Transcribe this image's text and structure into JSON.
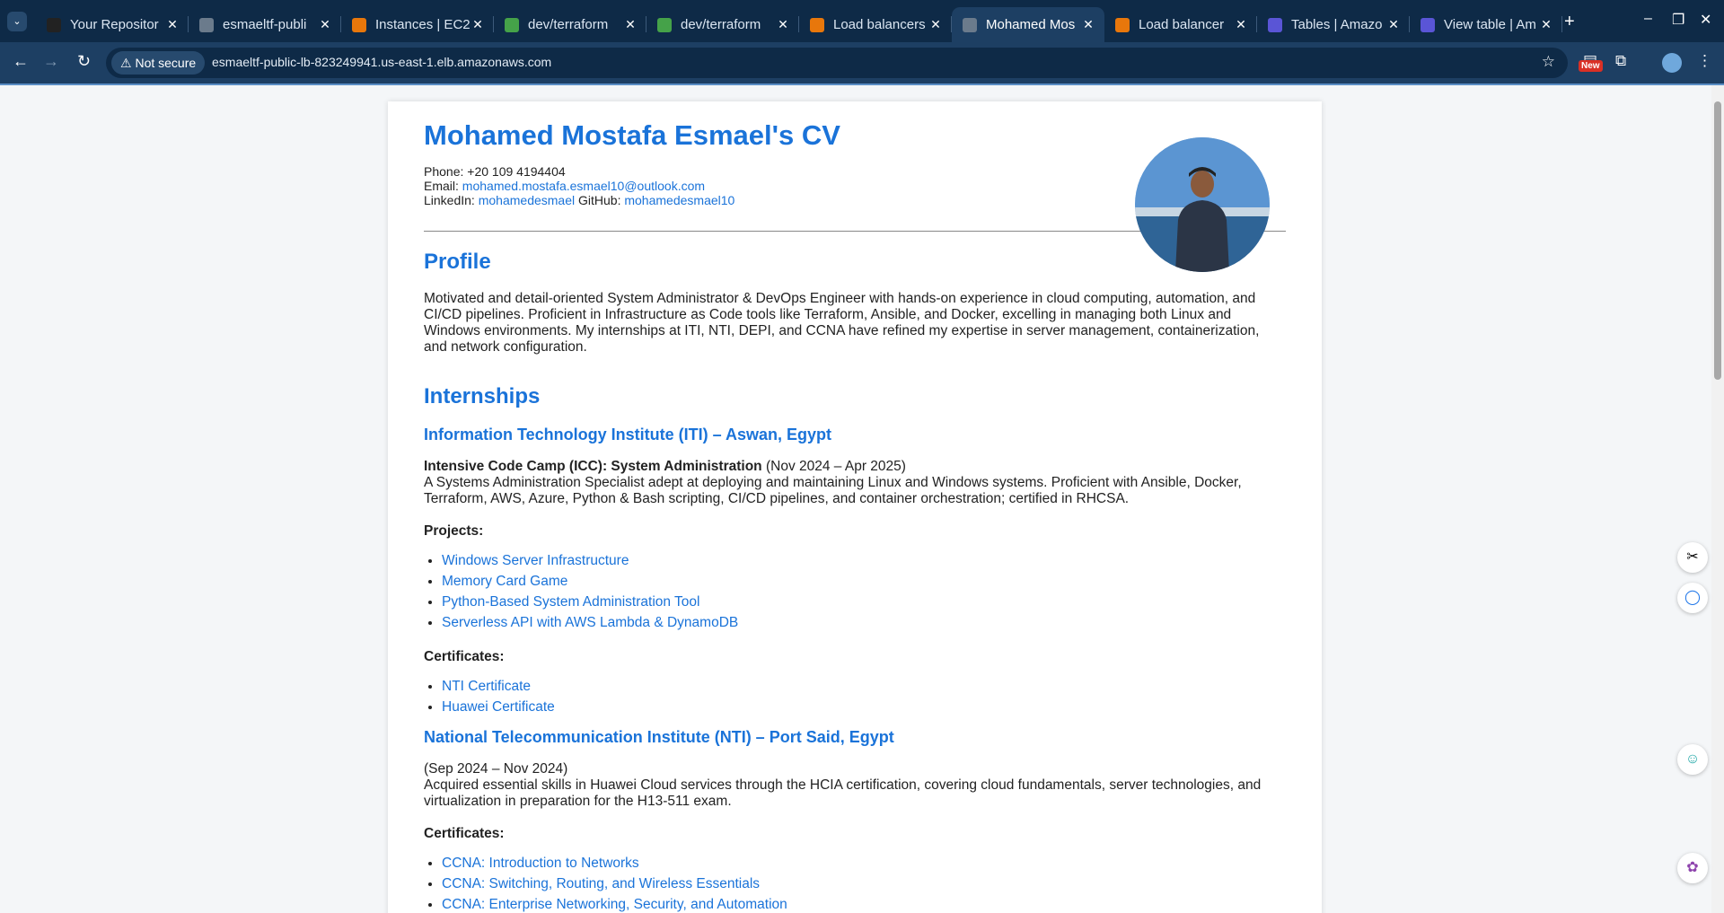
{
  "tabs": [
    {
      "title": "Your Repositor",
      "color": "#222222"
    },
    {
      "title": "esmaeltf-publi",
      "color": "#6b7b8c"
    },
    {
      "title": "Instances | EC2",
      "color": "#e8770b"
    },
    {
      "title": "dev/terraform",
      "color": "#45a249"
    },
    {
      "title": "dev/terraform",
      "color": "#45a249"
    },
    {
      "title": "Load balancers",
      "color": "#e8770b"
    },
    {
      "title": "Mohamed Mos",
      "color": "#6b7b8c",
      "active": true
    },
    {
      "title": "Load balancer",
      "color": "#e8770b"
    },
    {
      "title": "Tables | Amazo",
      "color": "#5a55d6"
    },
    {
      "title": "View table | Am",
      "color": "#5a55d6"
    }
  ],
  "toolbar": {
    "security_chip": "Not secure",
    "url": "esmaeltf-public-lb-823249941.us-east-1.elb.amazonaws.com",
    "new_badge": "New"
  },
  "cv": {
    "title": "Mohamed Mostafa Esmael's CV",
    "phone_label": "Phone:",
    "phone": "+20 109 4194404",
    "email_label": "Email:",
    "email": "mohamed.mostafa.esmael10@outlook.com",
    "linkedin_label": "LinkedIn:",
    "linkedin": "mohamedesmael",
    "github_label": "GitHub:",
    "github": "mohamedesmael10",
    "profile_heading": "Profile",
    "profile_text": "Motivated and detail-oriented System Administrator & DevOps Engineer with hands-on experience in cloud computing, automation, and CI/CD pipelines. Proficient in Infrastructure as Code tools like Terraform, Ansible, and Docker, excelling in managing both Linux and Windows environments. My internships at ITI, NTI, DEPI, and CCNA have refined my expertise in server management, containerization, and network configuration.",
    "internships_heading": "Internships",
    "iti": {
      "heading": "Information Technology Institute (ITI) – Aswan, Egypt",
      "program": "Intensive Code Camp (ICC): System Administration",
      "dates": "(Nov 2024 – Apr 2025)",
      "description": "A Systems Administration Specialist adept at deploying and maintaining Linux and Windows systems. Proficient with Ansible, Docker, Terraform, AWS, Azure, Python & Bash scripting, CI/CD pipelines, and container orchestration; certified in RHCSA.",
      "projects_label": "Projects:",
      "projects": [
        "Windows Server Infrastructure",
        "Memory Card Game",
        "Python-Based System Administration Tool",
        "Serverless API with AWS Lambda & DynamoDB"
      ],
      "certificates_label": "Certificates:",
      "certificates": [
        "NTI Certificate",
        "Huawei Certificate"
      ]
    },
    "nti": {
      "heading": "National Telecommunication Institute (NTI) – Port Said, Egypt",
      "dates": "(Sep 2024 – Nov 2024)",
      "description": "Acquired essential skills in Huawei Cloud services through the HCIA certification, covering cloud fundamentals, server technologies, and virtualization in preparation for the H13-511 exam.",
      "certificates_label": "Certificates:",
      "certificates": [
        "CCNA: Introduction to Networks",
        "CCNA: Switching, Routing, and Wireless Essentials",
        "CCNA: Enterprise Networking, Security, and Automation"
      ]
    }
  }
}
